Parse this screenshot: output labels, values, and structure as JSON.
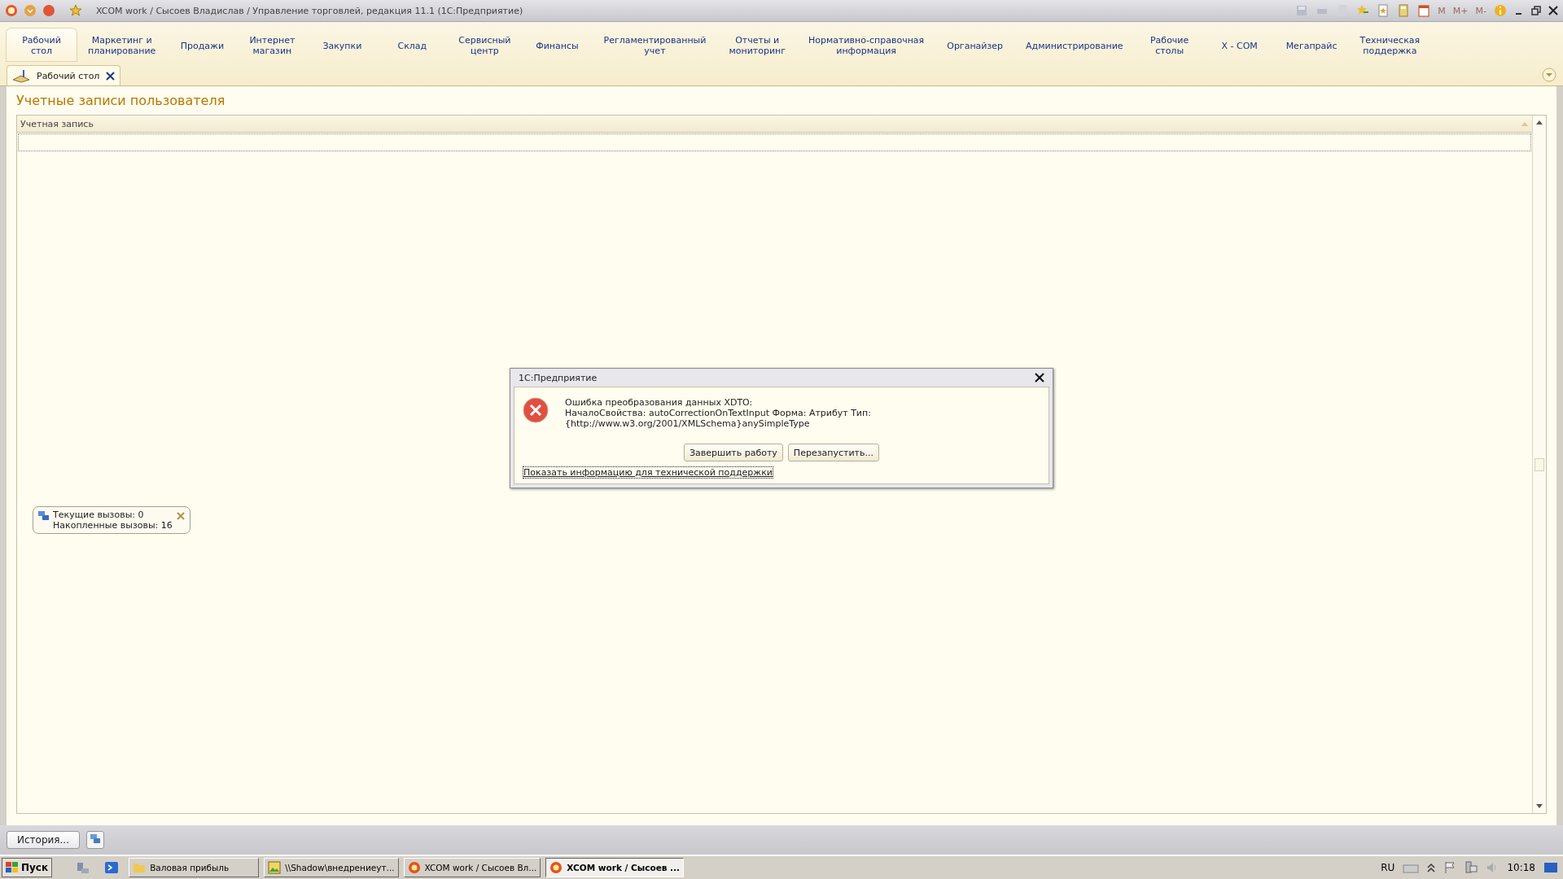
{
  "window": {
    "title": "XCOM work / Сысоев Владислав / Управление торговлей, редакция 11.1  (1С:Предприятие)",
    "memory_buttons": [
      {
        "label": "M",
        "disabled": true
      },
      {
        "label": "M+",
        "disabled": true
      },
      {
        "label": "M-",
        "disabled": true
      }
    ]
  },
  "sections": [
    {
      "label": "Рабочий\nстол",
      "selected": true
    },
    {
      "label": "Маркетинг и\nпланирование",
      "selected": false
    },
    {
      "label": "Продажи",
      "selected": false
    },
    {
      "label": "Интернет\nмагазин",
      "selected": false
    },
    {
      "label": "Закупки",
      "selected": false
    },
    {
      "label": "Склад",
      "selected": false
    },
    {
      "label": "Сервисный\nцентр",
      "selected": false
    },
    {
      "label": "Финансы",
      "selected": false
    },
    {
      "label": "Регламентированный\nучет",
      "selected": false
    },
    {
      "label": "Отчеты и\nмониторинг",
      "selected": false
    },
    {
      "label": "Нормативно-справочная\nинформация",
      "selected": false
    },
    {
      "label": "Органайзер",
      "selected": false
    },
    {
      "label": "Администрирование",
      "selected": false
    },
    {
      "label": "Рабочие\nстолы",
      "selected": false
    },
    {
      "label": "X - COM",
      "selected": false
    },
    {
      "label": "Мегапрайс",
      "selected": false
    },
    {
      "label": "Техническая\nподдержка",
      "selected": false
    }
  ],
  "open_tab": {
    "label": "Рабочий стол"
  },
  "form": {
    "title": "Учетные записи пользователя",
    "table": {
      "columns": [
        "Учетная запись"
      ]
    }
  },
  "calls_widget": {
    "current": "Текущие вызовы: 0",
    "accumulated": "Накопленные вызовы: 16"
  },
  "dialog": {
    "title": "1С:Предприятие",
    "message": [
      "Ошибка преобразования данных XDTO:",
      "НачалоСвойства: autoCorrectionOnTextInput    Форма: Атрибут    Тип:",
      "{http://www.w3.org/2001/XMLSchema}anySimpleType"
    ],
    "buttons": [
      "Завершить работу",
      "Перезапустить..."
    ],
    "link": "Показать информацию для технической поддержки"
  },
  "bottom_bar": {
    "history_button": "История..."
  },
  "taskbar": {
    "start": "Пуск",
    "items": [
      {
        "label": "Валовая прибыль",
        "kind": "folder",
        "selected": false
      },
      {
        "label": "\\\\Shadow\\внедрениеут...",
        "kind": "image",
        "selected": false
      },
      {
        "label": "XCOM work / Сысоев Вл...",
        "kind": "app",
        "selected": false
      },
      {
        "label": "XCOM work / Сысоев ...",
        "kind": "app",
        "selected": true
      }
    ],
    "language": "RU",
    "clock": "10:18"
  }
}
